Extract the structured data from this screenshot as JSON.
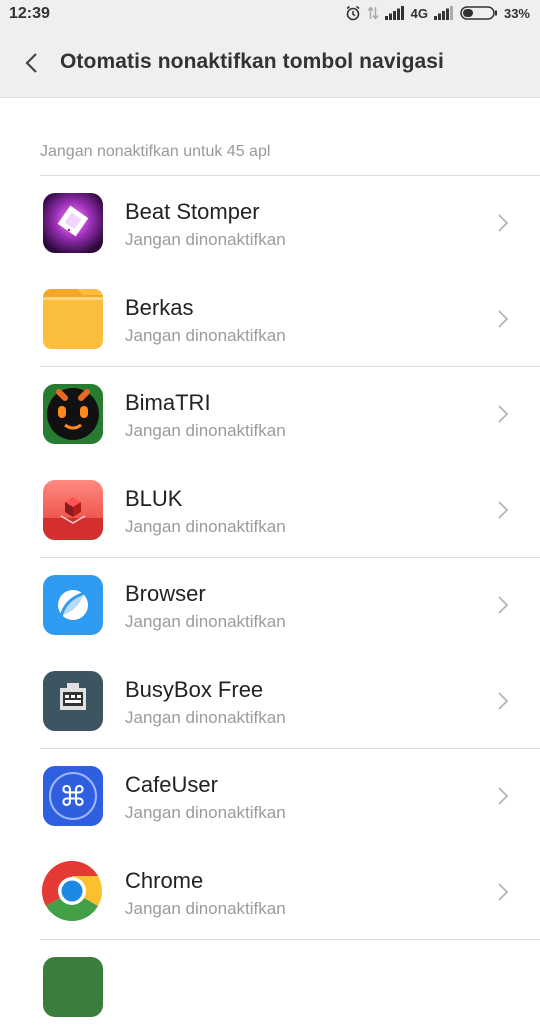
{
  "status": {
    "time": "12:39",
    "network": "4G",
    "battery": "33%"
  },
  "header": {
    "title": "Otomatis nonaktifkan tombol navigasi",
    "back_icon": "chevron-left-icon"
  },
  "section": {
    "label": "Jangan nonaktifkan untuk 45 apl"
  },
  "apps": [
    {
      "name": "Beat Stomper",
      "status": "Jangan dinonaktifkan",
      "icon": "beat-stomper-icon"
    },
    {
      "name": "Berkas",
      "status": "Jangan dinonaktifkan",
      "icon": "folder-icon"
    },
    {
      "name": "BimaTRI",
      "status": "Jangan dinonaktifkan",
      "icon": "bimatri-icon"
    },
    {
      "name": "BLUK",
      "status": "Jangan dinonaktifkan",
      "icon": "bluk-icon"
    },
    {
      "name": "Browser",
      "status": "Jangan dinonaktifkan",
      "icon": "browser-icon"
    },
    {
      "name": "BusyBox Free",
      "status": "Jangan dinonaktifkan",
      "icon": "busybox-icon"
    },
    {
      "name": "CafeUser",
      "status": "Jangan dinonaktifkan",
      "icon": "cafeuser-icon"
    },
    {
      "name": "Chrome",
      "status": "Jangan dinonaktifkan",
      "icon": "chrome-icon"
    }
  ],
  "colors": {
    "header_bg": "#efefef",
    "divider": "#dedede",
    "secondary_text": "#9b9b9b"
  }
}
